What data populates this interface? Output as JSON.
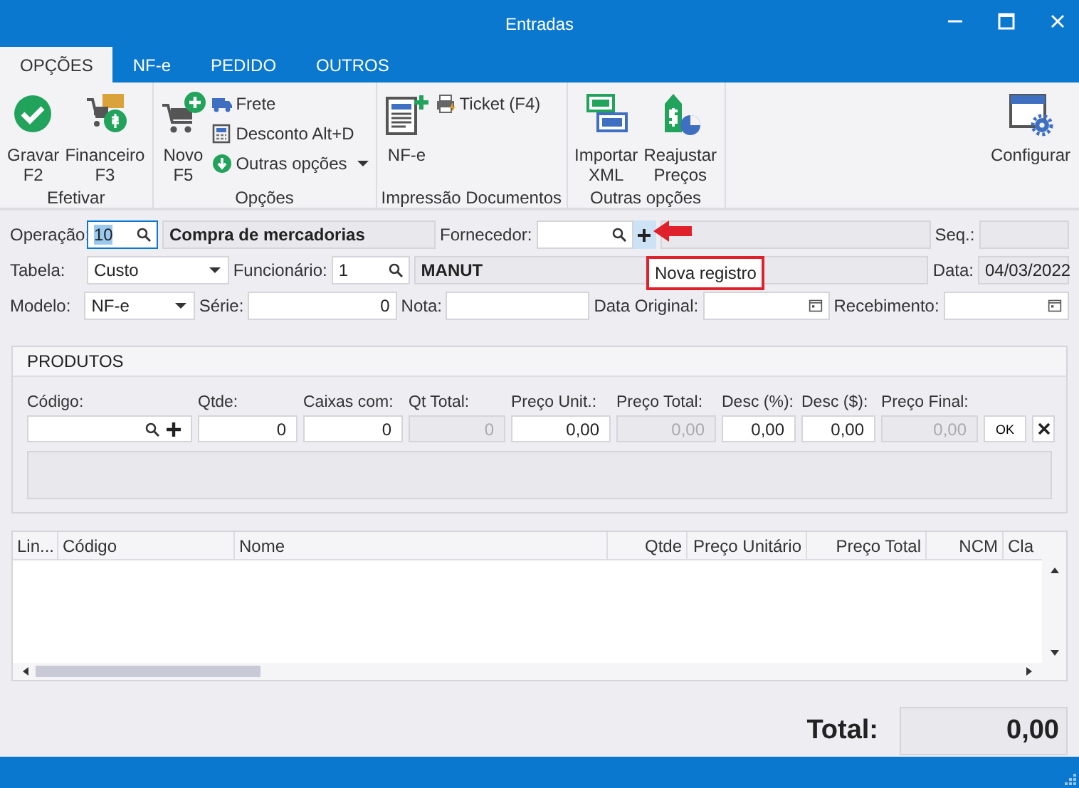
{
  "window": {
    "title": "Entradas"
  },
  "tabs": [
    {
      "label": "OPÇÕES",
      "selected": true
    },
    {
      "label": "NF-e",
      "selected": false
    },
    {
      "label": "PEDIDO",
      "selected": false
    },
    {
      "label": "OUTROS",
      "selected": false
    }
  ],
  "ribbon": {
    "groups": [
      {
        "label": "Efetivar",
        "items": [
          {
            "kind": "large",
            "lines": [
              "Gravar",
              "F2"
            ]
          },
          {
            "kind": "large",
            "lines": [
              "Financeiro",
              "F3"
            ]
          }
        ]
      },
      {
        "label": "Opções",
        "items": [
          {
            "kind": "large",
            "lines": [
              "Novo",
              "F5"
            ]
          },
          {
            "kind": "small",
            "label": "Frete"
          },
          {
            "kind": "small",
            "label": "Desconto Alt+D"
          },
          {
            "kind": "menu",
            "label": "Outras opções"
          }
        ]
      },
      {
        "label": "Impressão Documentos",
        "items": [
          {
            "kind": "large",
            "lines": [
              "NF-e"
            ]
          },
          {
            "kind": "small",
            "label": "Ticket (F4)"
          }
        ]
      },
      {
        "label": "Outras opções",
        "items": [
          {
            "kind": "large",
            "lines": [
              "Importar",
              "XML"
            ]
          },
          {
            "kind": "large",
            "lines": [
              "Reajustar",
              "Preços"
            ]
          }
        ]
      }
    ],
    "extra": {
      "kind": "large",
      "lines": [
        "Configurar"
      ]
    }
  },
  "form": {
    "operation": {
      "label": "Operação:",
      "code": "10",
      "code_selected": true,
      "name": "Compra de mercadorias"
    },
    "supplier": {
      "label": "Fornecedor:"
    },
    "seq": {
      "label": "Seq.:"
    },
    "table": {
      "label": "Tabela:",
      "value": "Custo"
    },
    "employee": {
      "label": "Funcionário:",
      "code": "1",
      "name": "MANUT"
    },
    "date": {
      "label": "Data:",
      "value": "04/03/2022"
    },
    "model": {
      "label": "Modelo:",
      "value": "NF-e"
    },
    "series": {
      "label": "Série:",
      "value": "0"
    },
    "number": {
      "label": "Nota:"
    },
    "original_date": {
      "label": "Data Original:"
    },
    "receipt": {
      "label": "Recebimento:"
    }
  },
  "tooltip": {
    "text": "Nova registro"
  },
  "products": {
    "title": "PRODUTOS",
    "fields": [
      {
        "label": "Código:",
        "kind": "lookup",
        "disabled": false
      },
      {
        "label": "Qtde:",
        "kind": "input",
        "value": "0",
        "disabled": false
      },
      {
        "label": "Caixas com:",
        "kind": "input",
        "value": "0",
        "disabled": false
      },
      {
        "label": "Qt Total:",
        "kind": "input",
        "value": "0",
        "disabled": true
      },
      {
        "label": "Preço Unit.:",
        "kind": "input",
        "value": "0,00",
        "disabled": false
      },
      {
        "label": "Preço Total:",
        "kind": "input",
        "value": "0,00",
        "disabled": true
      },
      {
        "label": "Desc (%):",
        "kind": "input",
        "value": "0,00",
        "disabled": false
      },
      {
        "label": "Desc ($):",
        "kind": "input",
        "value": "0,00",
        "disabled": false
      },
      {
        "label": "Preço Final:",
        "kind": "input",
        "value": "0,00",
        "disabled": true
      }
    ],
    "ok_button": "OK"
  },
  "table": {
    "columns": [
      {
        "label": "Lin...",
        "kind": "text"
      },
      {
        "label": "Código",
        "kind": "text"
      },
      {
        "label": "Nome",
        "kind": "text"
      },
      {
        "label": "Qtde",
        "kind": "number"
      },
      {
        "label": "Preço Unitário",
        "kind": "number"
      },
      {
        "label": "Preço Total",
        "kind": "number"
      },
      {
        "label": "NCM",
        "kind": "number"
      },
      {
        "label": "Cla",
        "kind": "text"
      }
    ]
  },
  "total": {
    "label": "Total:",
    "value": "0,00"
  }
}
